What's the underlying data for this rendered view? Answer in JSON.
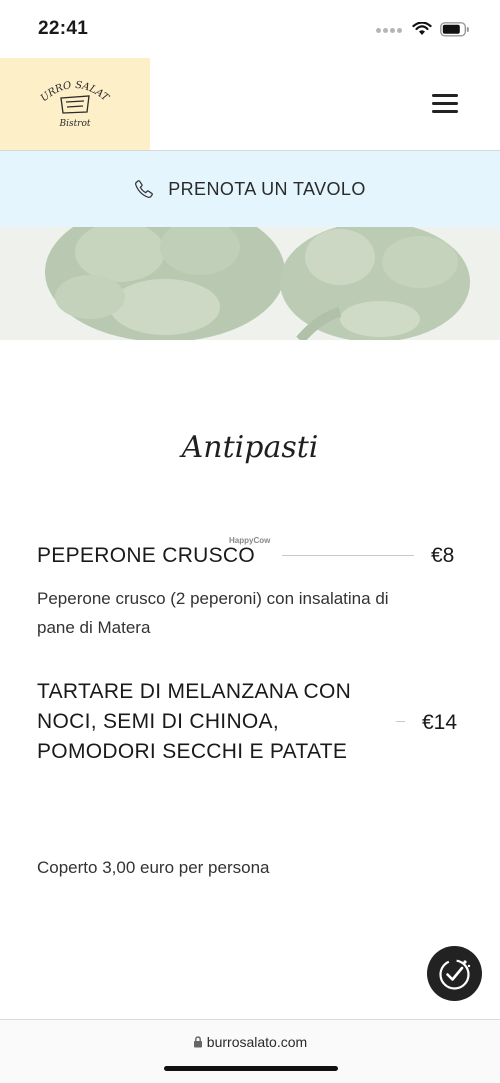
{
  "status_bar": {
    "time": "22:41"
  },
  "header": {
    "logo_line1": "BURRO SALATO",
    "logo_line2": "Bistrot",
    "menu_icon": "hamburger-icon"
  },
  "reserve": {
    "label": "PRENOTA UN TAVOLO",
    "icon": "phone-icon"
  },
  "menu": {
    "section_title": "Antipasti",
    "watermark": "HappyCow",
    "items": [
      {
        "name": "PEPERONE CRUSCO",
        "price": "€8",
        "description_line1": "Peperone crusco (2 peperoni) con insalatina di",
        "description_line2": "pane di Matera"
      },
      {
        "name_line1": "TARTARE DI MELANZANA CON",
        "name_line2": "NOCI, SEMI DI CHINOA,",
        "name_line3": "POMODORI SECCHI E PATATE",
        "price": "€14"
      }
    ],
    "cover_note": "Coperto 3,00 euro per persona"
  },
  "browser": {
    "url": "burrosalato.com"
  },
  "colors": {
    "logo_bg": "#fdefc7",
    "reserve_bg": "#e5f5fd",
    "fab_bg": "#222222"
  }
}
